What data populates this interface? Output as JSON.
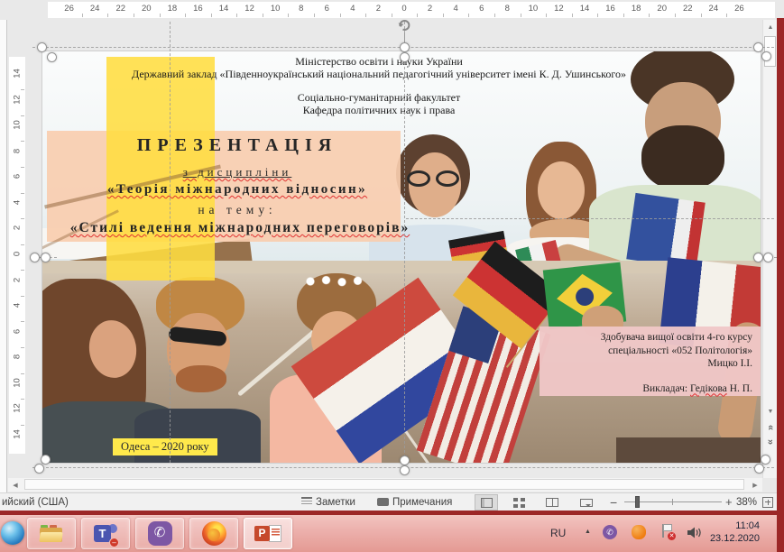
{
  "window": {
    "ruler_h": [
      "26",
      "24",
      "22",
      "20",
      "18",
      "16",
      "14",
      "12",
      "10",
      "8",
      "6",
      "4",
      "2",
      "0",
      "2",
      "4",
      "6",
      "8",
      "10",
      "12",
      "14",
      "16",
      "18",
      "20",
      "22",
      "24",
      "26"
    ],
    "ruler_v": [
      "14",
      "12",
      "10",
      "8",
      "6",
      "4",
      "2",
      "0",
      "2",
      "4",
      "6",
      "8",
      "10",
      "12",
      "14"
    ]
  },
  "slide": {
    "institution": {
      "line1": "Міністерство освіти і науки України",
      "line2": "Державний заклад «Південноукраїнський національний педагогічний університет імені К. Д. Ушинського»",
      "line3": "Соціально-гуманітарний факультет",
      "line4": "Кафедра політичних наук і права"
    },
    "title": {
      "presentation": "ПРЕЗЕНТАЦІЯ",
      "discipline_label": "з дисципліни",
      "discipline": "«Теорія міжнародних відносин»",
      "topic_label": "на тему:",
      "topic": "«Стилі ведення міжнародних переговорів»"
    },
    "credits": {
      "line1": "Здобувача вищої освіти 4-го курсу",
      "line2": "спеціальності «052 Політологія»",
      "line3": "Мицко І.І.",
      "teacher_prefix": "Викладач: ",
      "teacher_name": "Гедікова",
      "teacher_suffix": " Н. П."
    },
    "footer": "Одеса – 2020 року"
  },
  "status_bar": {
    "language": "ийский (США)",
    "notes_label": "Заметки",
    "comments_label": "Примечания",
    "zoom_level": "38%"
  },
  "taskbar": {
    "language_indicator": "RU",
    "time": "11:04",
    "date": "23.12.2020",
    "icons": [
      "start",
      "file-explorer",
      "microsoft-teams",
      "viber",
      "firefox",
      "powerpoint"
    ]
  },
  "colors": {
    "accent_yellow_band": "#FFDD40",
    "peach_text_box": "#F8CDAF",
    "pink_credits_box": "#EFC7C7",
    "footer_yellow": "#FFE94B",
    "window_edge_red": "#9C2727",
    "taskbar_pink": "#ECAFAB",
    "statusbar_gray": "#F1F1F1"
  }
}
